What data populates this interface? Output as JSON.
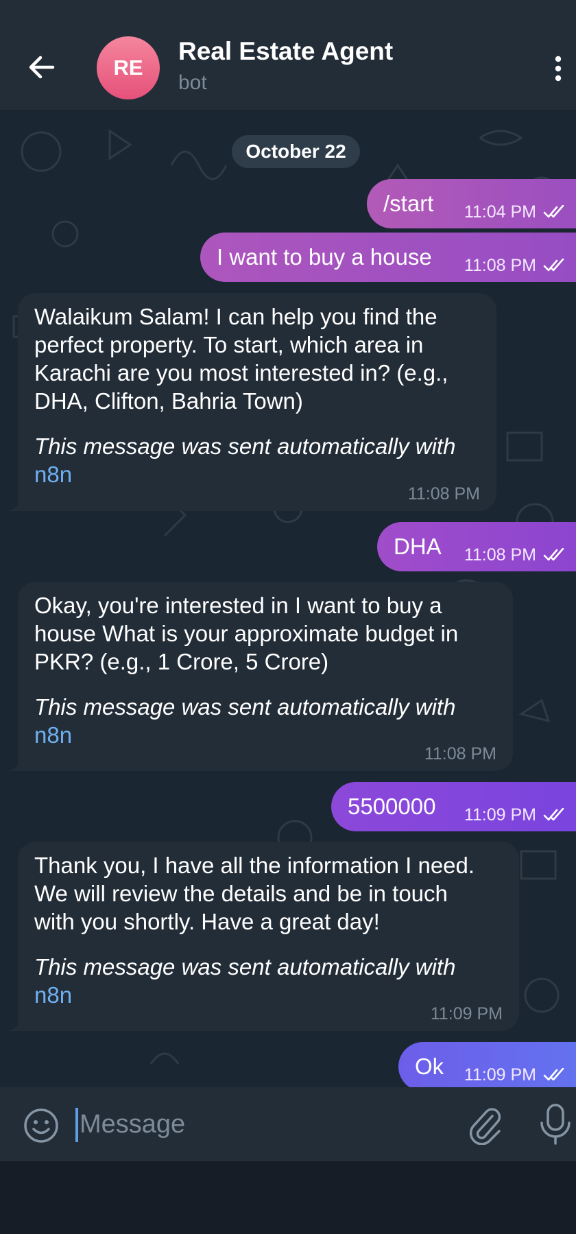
{
  "header": {
    "back_icon": "arrow-left-icon",
    "avatar_initials": "RE",
    "avatar_gradient": [
      "#f5869d",
      "#e5517a"
    ],
    "title": "Real Estate Agent",
    "subtitle": "bot",
    "menu_icon": "more-vertical-icon"
  },
  "chat": {
    "date_label": "October 22",
    "outgoing_gradients": {
      "start": [
        "#b35ab8",
        "#9b4fc0"
      ],
      "house": [
        "#ad56bd",
        "#964dc3"
      ],
      "dha": [
        "#a04dca",
        "#8c45cf"
      ],
      "budget": [
        "#8c48d9",
        "#7a44de"
      ],
      "ok": [
        "#6d5ee9",
        "#6372ef"
      ]
    },
    "messages": [
      {
        "id": "m1",
        "direction": "out",
        "text": "/start",
        "time": "11:04 PM",
        "status": "read"
      },
      {
        "id": "m2",
        "direction": "out",
        "text": "I want to buy a house",
        "time": "11:08 PM",
        "status": "read"
      },
      {
        "id": "m3",
        "direction": "in",
        "text": "Walaikum Salam! I can help you find the\nperfect property. To start, which area in\nKarachi are you most interested in? (e.g.,\nDHA, Clifton, Bahria Town)",
        "footer": "This message was sent automatically with",
        "link": "n8n",
        "time": "11:08 PM"
      },
      {
        "id": "m4",
        "direction": "out",
        "text": "DHA",
        "time": "11:08 PM",
        "status": "read"
      },
      {
        "id": "m5",
        "direction": "in",
        "text": "Okay, you're interested in I want to buy a\nhouse  What is your approximate budget in\nPKR? (e.g., 1 Crore, 5 Crore)",
        "footer": "This message was sent automatically with",
        "link": "n8n",
        "time": "11:08 PM"
      },
      {
        "id": "m6",
        "direction": "out",
        "text": "5500000",
        "time": "11:09 PM",
        "status": "read"
      },
      {
        "id": "m7",
        "direction": "in",
        "text": "Thank you, I have all the information I need.\nWe will review the details and be in touch\nwith you shortly. Have a great day!",
        "footer": "This message was sent automatically with",
        "link": "n8n",
        "time": "11:09 PM"
      },
      {
        "id": "m8",
        "direction": "out",
        "text": "Ok",
        "time": "11:09 PM",
        "status": "read"
      }
    ]
  },
  "composer": {
    "emoji_icon": "smile-icon",
    "placeholder": "Message",
    "attach_icon": "paperclip-icon",
    "mic_icon": "microphone-icon"
  },
  "colors": {
    "header_bg": "#232d38",
    "chat_bg": "#1a2631",
    "incoming_bubble": "#232d38",
    "link": "#6fb0f0",
    "muted": "#7d8b99"
  }
}
